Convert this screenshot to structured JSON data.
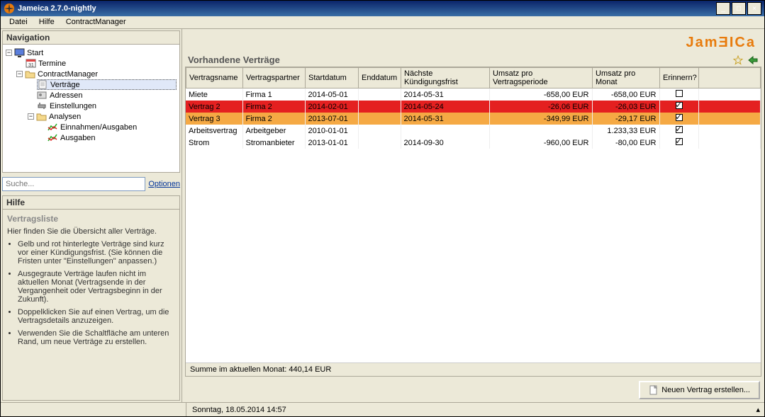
{
  "window": {
    "title": "Jameica 2.7.0-nightly"
  },
  "menu": [
    "Datei",
    "Hilfe",
    "ContractManager"
  ],
  "nav": {
    "title": "Navigation",
    "tree": {
      "start": "Start",
      "termine": "Termine",
      "contractmanager": "ContractManager",
      "vertraege": "Verträge",
      "adressen": "Adressen",
      "einstellungen": "Einstellungen",
      "analysen": "Analysen",
      "einnahmen_ausgaben": "Einnahmen/Ausgaben",
      "ausgaben": "Ausgaben"
    },
    "search_placeholder": "Suche...",
    "optionen": "Optionen"
  },
  "hilfe": {
    "title": "Hilfe",
    "heading": "Vertragsliste",
    "intro": "Hier finden Sie die Übersicht aller Verträge.",
    "bullets": [
      "Gelb und rot hinterlegte Verträge sind kurz vor einer Kündigungsfrist. (Sie können die Fristen unter \"Einstellungen\" anpassen.)",
      "Ausgegraute Verträge laufen nicht im aktuellen Monat (Vertragsende in der Vergangenheit oder Vertragsbeginn in der Zukunft).",
      "Doppelklicken Sie auf einen Vertrag, um die Vertragsdetails anzuzeigen.",
      "Verwenden Sie die Schaltfläche am unteren Rand, um neue Verträge zu erstellen."
    ]
  },
  "logo_text": "JamƎICa",
  "content": {
    "title": "Vorhandene Verträge",
    "columns": [
      "Vertragsname",
      "Vertragspartner",
      "Startdatum",
      "Enddatum",
      "Nächste Kündigungsfrist",
      "Umsatz pro Vertragsperiode",
      "Umsatz pro Monat",
      "Erinnern?"
    ],
    "rows": [
      {
        "name": "Miete",
        "partner": "Firma 1",
        "start": "2014-05-01",
        "end": "",
        "kuend": "2014-05-31",
        "u_per": "-658,00 EUR",
        "u_mon": "-658,00 EUR",
        "remind": false,
        "cls": ""
      },
      {
        "name": "Vertrag 2",
        "partner": "Firma 2",
        "start": "2014-02-01",
        "end": "",
        "kuend": "2014-05-24",
        "u_per": "-26,06 EUR",
        "u_mon": "-26,03 EUR",
        "remind": true,
        "cls": "row-red"
      },
      {
        "name": "Vertrag 3",
        "partner": "Firma 2",
        "start": "2013-07-01",
        "end": "",
        "kuend": "2014-05-31",
        "u_per": "-349,99 EUR",
        "u_mon": "-29,17 EUR",
        "remind": true,
        "cls": "row-orange"
      },
      {
        "name": "Arbeitsvertrag",
        "partner": "Arbeitgeber",
        "start": "2010-01-01",
        "end": "",
        "kuend": "",
        "u_per": "",
        "u_mon": "1.233,33 EUR",
        "remind": true,
        "cls": ""
      },
      {
        "name": "Strom",
        "partner": "Stromanbieter",
        "start": "2013-01-01",
        "end": "",
        "kuend": "2014-09-30",
        "u_per": "-960,00 EUR",
        "u_mon": "-80,00 EUR",
        "remind": true,
        "cls": ""
      }
    ],
    "summary": "Summe im aktuellen Monat: 440,14 EUR",
    "new_contract_btn": "Neuen Vertrag erstellen..."
  },
  "status": {
    "datetime": "Sonntag, 18.05.2014 14:57"
  }
}
